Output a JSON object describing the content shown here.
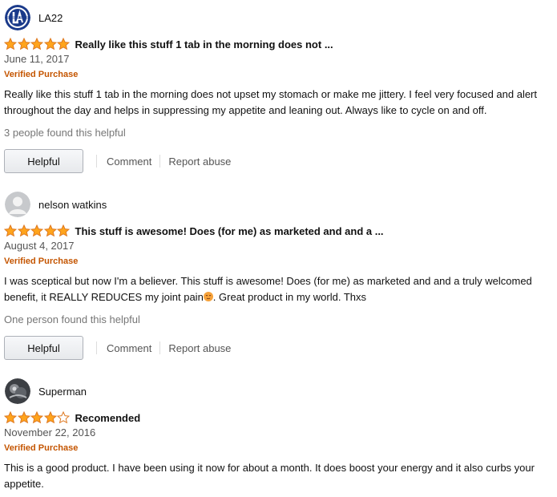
{
  "reviews": [
    {
      "reviewer": "LA22",
      "avatar_icon": "dodgers-logo-avatar-icon",
      "rating": 5,
      "title": "Really like this stuff 1 tab in the morning does not ...",
      "date": "June 11, 2017",
      "verified": "Verified Purchase",
      "body": "Really like this stuff 1 tab in the morning does not upset my stomach or make me jittery. I feel very focused and alert throughout the day and helps in suppressing my appetite and leaning out. Always like to cycle on and off.",
      "helpful_count": "3 people found this helpful",
      "helpful_button": "Helpful",
      "comment": "Comment",
      "report": "Report abuse"
    },
    {
      "reviewer": "nelson watkins",
      "avatar_icon": "default-user-avatar-icon",
      "rating": 5,
      "title": "This stuff is awesome! Does (for me) as marketed and and a ...",
      "date": "August 4, 2017",
      "verified": "Verified Purchase",
      "body_part1": "I was sceptical but now I'm a believer. This stuff is awesome! Does (for me) as marketed and and a truly welcomed benefit, it REALLY REDUCES my joint pain",
      "body_part2": ". Great product in my world. Thxs",
      "emoji_icon": "relieved-face-emoji-icon",
      "helpful_count": "One person found this helpful",
      "helpful_button": "Helpful",
      "comment": "Comment",
      "report": "Report abuse"
    },
    {
      "reviewer": "Superman",
      "avatar_icon": "photo-avatar-icon",
      "rating": 4,
      "title": "Recomended",
      "date": "November 22, 2016",
      "verified": "Verified Purchase",
      "body": "This is a good product. I have been using it now for about a month. It does boost your energy and it also curbs your appetite."
    }
  ],
  "colors": {
    "star_fill": "#ffa41c",
    "star_stroke": "#de7921",
    "verified": "#c45500"
  }
}
